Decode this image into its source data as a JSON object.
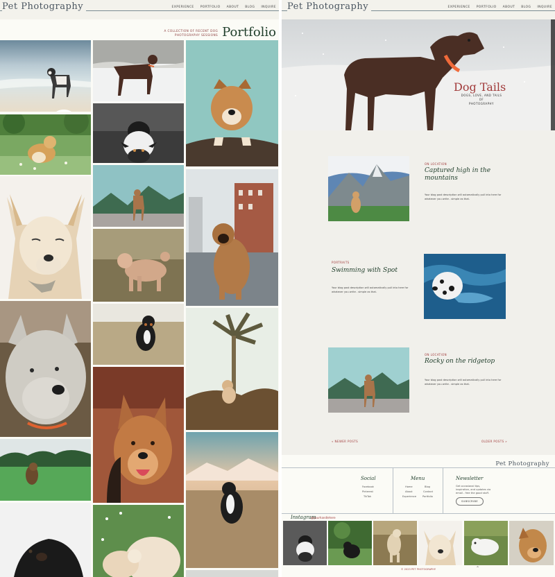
{
  "site": {
    "logo": "Pet Photography",
    "nav": [
      "EXPERIENCE",
      "PORTFOLIO",
      "ABOUT",
      "BLOG",
      "INQUIRE"
    ]
  },
  "portfolio": {
    "subtitle_line1": "A COLLECTION OF RECENT DOG",
    "subtitle_line2": "PHOTOGRAPHY SESSIONS",
    "title": "Portfolio"
  },
  "blog": {
    "hero_title": "Dog Tails",
    "hero_sub_line1": "DOGS, LOVE, AND TAILS OF",
    "hero_sub_line2": "PHOTOGRAPHY",
    "posts": [
      {
        "category": "ON LOCATION",
        "title_line1": "Captured high in the",
        "title_line2": "mountains",
        "desc_line1": "Your blog post description will automatically pull into here for",
        "desc_line2": "whatever you write - simple as that."
      },
      {
        "category": "PORTRAITS",
        "title_line1": "Swimming with Spot",
        "title_line2": "",
        "desc_line1": "Your blog post description will automatically pull into here for",
        "desc_line2": "whatever you write - simple as that."
      },
      {
        "category": "ON LOCATION",
        "title_line1": "Rocky on the ridgetop",
        "title_line2": "",
        "desc_line1": "Your blog post description will automatically pull into here for",
        "desc_line2": "whatever you write - simple as that."
      }
    ],
    "newer": "« NEWER POSTS",
    "older": "OLDER POSTS »"
  },
  "footer": {
    "logo": "Pet Photography",
    "social_heading": "Social",
    "social_links": [
      "Facebook",
      "Pinterest",
      "TikTok"
    ],
    "menu_heading": "Menu",
    "menu_links_col1": [
      "Home",
      "About",
      "Experience"
    ],
    "menu_links_col2": [
      "Blog",
      "Contact",
      "Portfolio"
    ],
    "newsletter_heading": "Newsletter",
    "newsletter_line1": "Get occasional tips,",
    "newsletter_line2": "inspiration, and updates via",
    "newsletter_line3": "email - free the good stuff.",
    "subscribe_label": "SUBSCRIBE",
    "instagram_label": "Instagram",
    "instagram_handle": "@yourhandlehere",
    "copyright": "© 2023 PET PHOTOGRAPHY",
    "up_icon": "chevron-up-icon"
  },
  "colors": {
    "accent": "#a13b3b",
    "heading": "#1f3d2a",
    "background": "#f1f0eb"
  }
}
